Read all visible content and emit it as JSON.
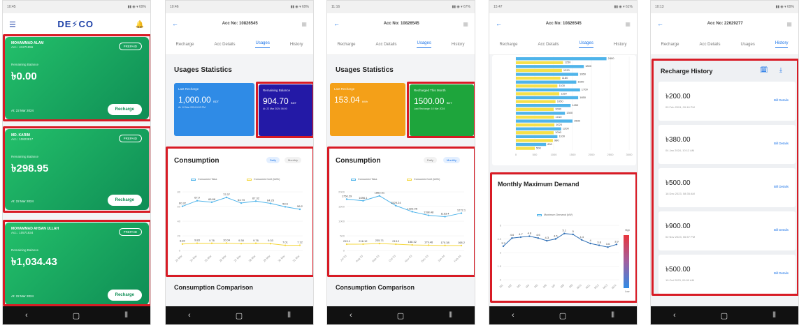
{
  "dashboard": {
    "logo": "DE⚡CO",
    "accounts": [
      {
        "name": "MOHAMMAD ALAM",
        "acc": "Acc.: 41271956",
        "balance_label": "Remaining Balance",
        "amount": "৳0.00",
        "date": "At: 22 Mar 2024",
        "prepaid": "PREPAID",
        "recharge": "Recharge"
      },
      {
        "name": "MD. KARIM",
        "acc": "Acc.: 10823917",
        "balance_label": "Remaining Balance",
        "amount": "৳298.95",
        "date": "At: 22 Mar 2024",
        "prepaid": "PREPAID",
        "recharge": "Recharge"
      },
      {
        "name": "MOHAMMAD AHSAN ULLAH",
        "acc": "Acc.: 10571834",
        "balance_label": "Remaining Balance",
        "amount": "৳1,034.43",
        "date": "At: 22 Mar 2024",
        "prepaid": "PREPAID",
        "recharge": "Recharge"
      }
    ]
  },
  "usage_a": {
    "acc_title": "Acc No: 10826545",
    "tabs": [
      "Recharge",
      "Acc Details",
      "Usages",
      "History"
    ],
    "stats_title": "Usages Statistics",
    "box1": {
      "label": "Last Recharge",
      "value": "1,000.00",
      "unit": "BDT",
      "date": "At: 10 Mar 2024 6:53 PM",
      "color": "#2f8be6"
    },
    "box2": {
      "label": "Remaining Balance",
      "value": "904.70",
      "unit": "BDT",
      "date": "At: 22 Mar 2024 06:00",
      "color": "#2319a6"
    },
    "consumption_title": "Consumption",
    "toggle": [
      "Daily",
      "Monthly"
    ],
    "legend": [
      "Consumed Taka",
      "Consumed Unit (kWh)"
    ],
    "comparison_title": "Consumption Comparison"
  },
  "usage_b": {
    "acc_title": "Acc No: 10826545",
    "tabs": [
      "Recharge",
      "Acc Details",
      "Usages",
      "History"
    ],
    "stats_title": "Usages Statistics",
    "box1": {
      "label": "Last Recharge",
      "value": "153.04",
      "unit": "kWh",
      "date": "",
      "color": "#f4a018"
    },
    "box2": {
      "label": "Recharged This Month",
      "value": "1500.00",
      "unit": "BDT",
      "date": "Last Recharge: 10 Mar 2024",
      "color": "#1ea53c"
    },
    "consumption_title": "Consumption",
    "toggle": [
      "Daily",
      "Monthly"
    ],
    "legend": [
      "Consumed Taka",
      "Consumed Unit (kWh)"
    ],
    "comparison_title": "Consumption Comparison"
  },
  "usage_c": {
    "acc_title": "Acc No: 10826545",
    "tabs": [
      "Recharge",
      "Acc Details",
      "Usages",
      "History"
    ],
    "demand_title": "Monthly Maximum Demand",
    "demand_legend": "Maximum Demand (kW)",
    "scale_high": "High",
    "scale_low": "Low"
  },
  "history": {
    "acc_title": "Acc No: 22629277",
    "tabs": [
      "Recharge",
      "Acc Details",
      "Usages",
      "History"
    ],
    "title": "Recharge History",
    "bill_label": "Bill Details",
    "items": [
      {
        "amount": "৳200.00",
        "date": "09 Feb 2024, 09:16 PM"
      },
      {
        "amount": "৳380.00",
        "date": "04 Jan 2024, 10:12 AM"
      },
      {
        "amount": "৳500.00",
        "date": "18 Dec 2023, 08:35 AM"
      },
      {
        "amount": "৳900.00",
        "date": "02 Nov 2023, 06:57 PM"
      },
      {
        "amount": "৳500.00",
        "date": "10 Oct 2023, 09:00 AM"
      }
    ]
  },
  "chart_data": [
    {
      "type": "line",
      "x": [
        "23 Mar",
        "24 Mar",
        "25 Mar",
        "26 Mar",
        "27 Mar",
        "28 Mar",
        "29 Mar",
        "30 Mar",
        "31 Mar"
      ],
      "series": [
        {
          "name": "Consumed Taka",
          "values": [
            60.32,
            67.9,
            65.88,
            72.37,
            64.73,
            67.32,
            64.25,
            59.6,
            56.2
          ],
          "color": "#4fb4ea"
        },
        {
          "name": "Consumed Unit (kWh)",
          "values": [
            8.82,
            9.83,
            9.76,
            10.04,
            9.38,
            9.76,
            9.33,
            7.01,
            7.12
          ],
          "color": "#f5d73d"
        }
      ],
      "ylim": [
        0,
        80
      ]
    },
    {
      "type": "line",
      "x": [
        "Jul-23",
        "Aug-23",
        "Sep-23",
        "Oct-23",
        "Nov-23",
        "Dec-23",
        "Jan-24",
        "Feb-24"
      ],
      "series": [
        {
          "name": "Consumed Taka",
          "values": [
            1750.29,
            1696.1,
            1863.61,
            1529.24,
            1323.05,
            1198.48,
            1153.4,
            1272.1
          ],
          "color": "#4fb4ea"
        },
        {
          "name": "Consumed Unit (kWh)",
          "values": [
            213.1,
            216.12,
            235.71,
            213.2,
            188.32,
            179.46,
            170.38,
            168.2
          ],
          "color": "#f5d73d"
        }
      ],
      "ylim": [
        0,
        2000
      ]
    },
    {
      "type": "bar",
      "orientation": "horizontal",
      "series": [
        {
          "name": "",
          "values": [
            2400,
            1800,
            1650,
            1600,
            1700,
            1650,
            1450,
            1300,
            1500,
            1200,
            1100,
            800
          ],
          "color": "#4fb4ea"
        },
        {
          "name": "",
          "values": [
            1250,
            1220,
            1180,
            1100,
            1150,
            1050,
            1000,
            1010,
            1020,
            1000,
            980,
            500
          ],
          "color": "#f5e04a"
        }
      ],
      "xlim": [
        0,
        3000
      ]
    },
    {
      "type": "line",
      "x": [
        "M1",
        "M2",
        "M3",
        "M4",
        "M5",
        "M6",
        "M7",
        "M8",
        "M9",
        "M10",
        "M11",
        "M12",
        "M13",
        "M14"
      ],
      "series": [
        {
          "name": "Maximum Demand (kW)",
          "values": [
            3.7,
            4.6,
            4.7,
            4.8,
            4.6,
            4.3,
            4.5,
            5.1,
            5.0,
            4.4,
            4.0,
            3.8,
            3.6,
            3.9
          ],
          "color": "#2f6fb5"
        }
      ],
      "ylim": [
        0,
        6
      ]
    }
  ]
}
